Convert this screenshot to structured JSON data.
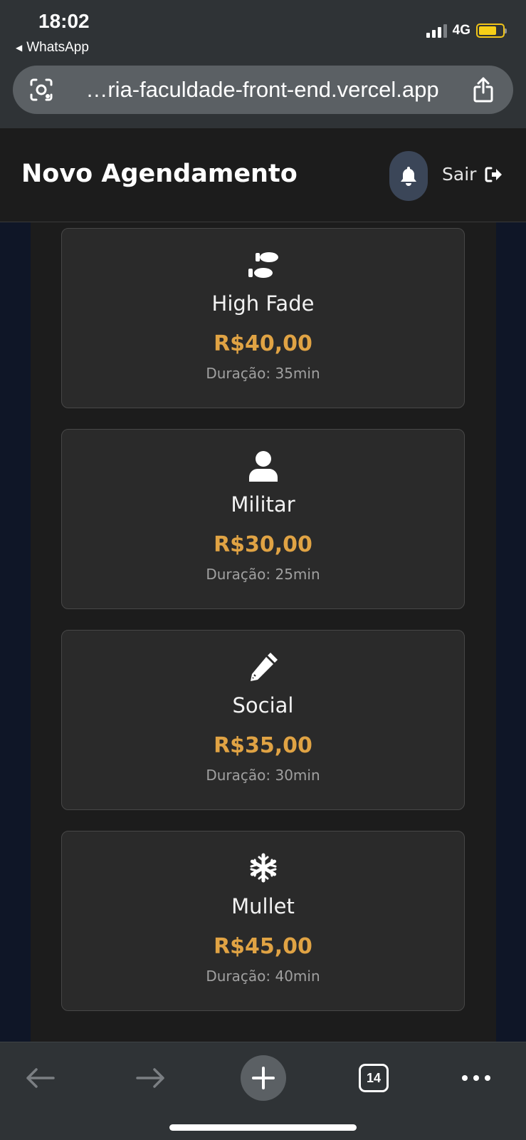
{
  "status_bar": {
    "time": "18:02",
    "back_app": "WhatsApp",
    "network": "4G"
  },
  "browser": {
    "url": "…ria-faculdade-front-end.vercel.app"
  },
  "header": {
    "title": "Novo Agendamento",
    "logout_label": "Sair"
  },
  "services": [
    {
      "icon": "shoe-prints-icon",
      "name": "High Fade",
      "price": "R$40,00",
      "duration": "Duração: 35min"
    },
    {
      "icon": "user-icon",
      "name": "Militar",
      "price": "R$30,00",
      "duration": "Duração: 25min"
    },
    {
      "icon": "pencil-icon",
      "name": "Social",
      "price": "R$35,00",
      "duration": "Duração: 30min"
    },
    {
      "icon": "snowflake-icon",
      "name": "Mullet",
      "price": "R$45,00",
      "duration": "Duração: 40min"
    }
  ],
  "toolbar": {
    "tab_count": "14"
  },
  "colors": {
    "price": "#e0a344",
    "card_bg": "#2a2a2a",
    "page_bg": "#0f1627",
    "accent_bell": "#3b4658"
  }
}
